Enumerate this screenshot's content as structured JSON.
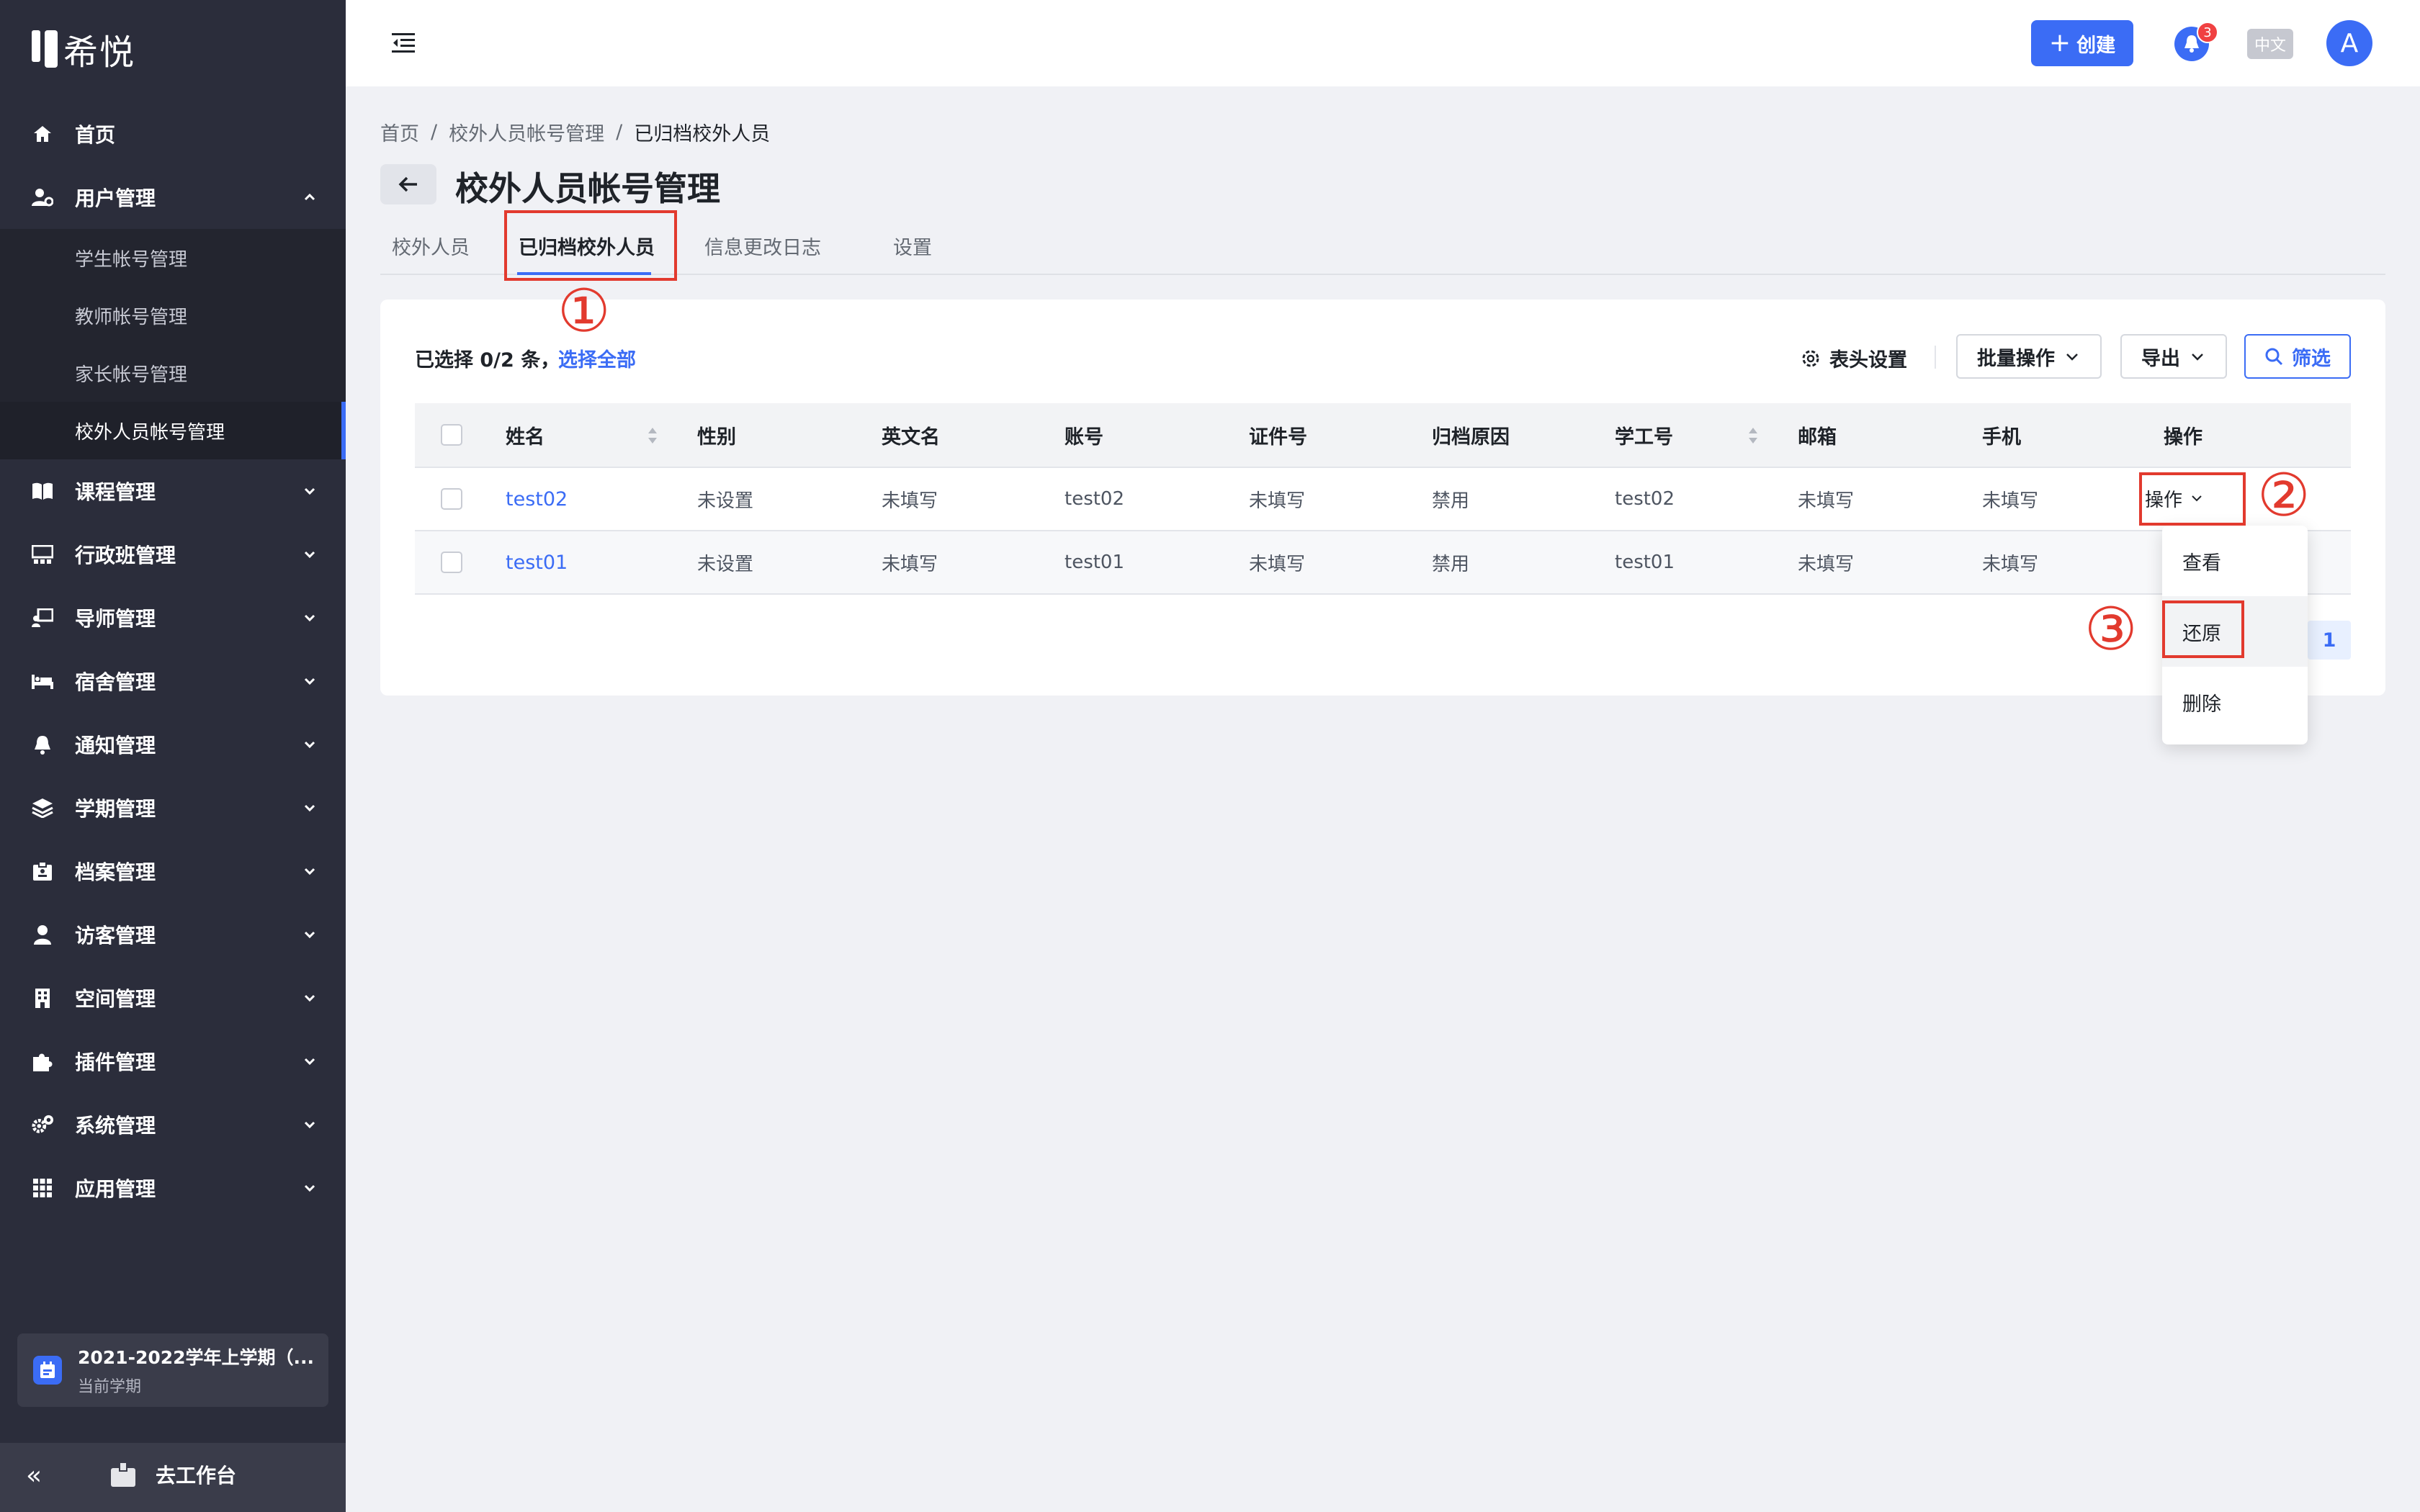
{
  "app": {
    "logo_text": "希悦"
  },
  "sidebar": {
    "items": [
      {
        "label": "首页",
        "icon": "home-icon"
      },
      {
        "label": "用户管理",
        "icon": "user-gear-icon",
        "expanded": true
      },
      {
        "label": "课程管理",
        "icon": "book-icon"
      },
      {
        "label": "行政班管理",
        "icon": "class-icon"
      },
      {
        "label": "导师管理",
        "icon": "mentor-icon"
      },
      {
        "label": "宿舍管理",
        "icon": "bed-icon"
      },
      {
        "label": "通知管理",
        "icon": "bell-icon"
      },
      {
        "label": "学期管理",
        "icon": "layers-icon"
      },
      {
        "label": "档案管理",
        "icon": "archive-icon"
      },
      {
        "label": "访客管理",
        "icon": "visitor-icon"
      },
      {
        "label": "空间管理",
        "icon": "building-icon"
      },
      {
        "label": "插件管理",
        "icon": "puzzle-icon"
      },
      {
        "label": "系统管理",
        "icon": "gears-icon"
      },
      {
        "label": "应用管理",
        "icon": "grid-icon"
      }
    ],
    "submenu": [
      "学生帐号管理",
      "教师帐号管理",
      "家长帐号管理",
      "校外人员帐号管理"
    ],
    "semester": {
      "title": "2021-2022学年上学期（...",
      "subtitle": "当前学期"
    },
    "footer": {
      "collapse": "«",
      "workbench": "去工作台"
    }
  },
  "topbar": {
    "create_label": "创建",
    "notification_count": "3",
    "lang_label": "中文",
    "avatar_letter": "A"
  },
  "breadcrumb": [
    "首页",
    "校外人员帐号管理",
    "已归档校外人员"
  ],
  "breadcrumb_sep": "/",
  "page": {
    "title": "校外人员帐号管理"
  },
  "tabs": [
    "校外人员",
    "已归档校外人员",
    "信息更改日志",
    "设置"
  ],
  "active_tab": "已归档校外人员",
  "toolbar": {
    "selection_text": "已选择 0/2 条，",
    "select_all": "选择全部",
    "header_settings": "表头设置",
    "batch_ops": "批量操作",
    "export": "导出",
    "filter": "筛选"
  },
  "table": {
    "columns": [
      "姓名",
      "性别",
      "英文名",
      "账号",
      "证件号",
      "归档原因",
      "学工号",
      "邮箱",
      "手机",
      "操作"
    ],
    "rows": [
      {
        "name": "test02",
        "gender": "未设置",
        "english_name": "未填写",
        "account": "test02",
        "id_number": "未填写",
        "archive_reason": "禁用",
        "staff_no": "test02",
        "email": "未填写",
        "phone": "未填写"
      },
      {
        "name": "test01",
        "gender": "未设置",
        "english_name": "未填写",
        "account": "test01",
        "id_number": "未填写",
        "archive_reason": "禁用",
        "staff_no": "test01",
        "email": "未填写",
        "phone": "未填写"
      }
    ],
    "ops_label": "操作",
    "dropdown": [
      "查看",
      "还原",
      "删除"
    ],
    "page": "1"
  },
  "annotations": [
    "①",
    "②",
    "③"
  ],
  "colors": {
    "accent": "#3b6cf5",
    "sidebar_bg": "#2b2d3b",
    "annotation": "#e23a2e"
  }
}
